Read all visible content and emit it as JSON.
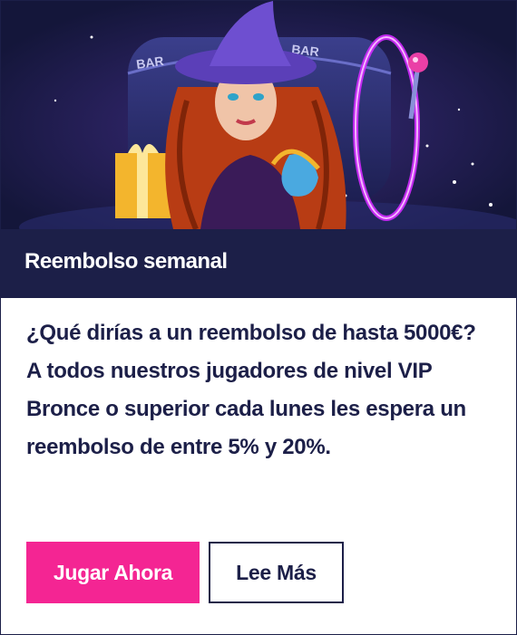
{
  "hero": {
    "image_alt": "Witch with slot machine",
    "slot_text": [
      "BAR",
      "BAR"
    ],
    "colors": {
      "bg": "#14163a",
      "neon": "#d22aff",
      "hat": "#5b3fb8",
      "hair": "#b83c14",
      "gift": "#f3b52d"
    }
  },
  "promo": {
    "title": "Reembolso semanal",
    "description": "¿Qué dirías a un reembolso de hasta 5000€? A todos nuestros jugadores de nivel VIP Bronce o superior cada lunes les espera un reembolso de entre 5% y 20%."
  },
  "buttons": {
    "play_label": "Jugar Ahora",
    "read_more_label": "Lee Más"
  },
  "colors": {
    "navy": "#1c1f48",
    "pink": "#f42593",
    "white": "#ffffff"
  }
}
